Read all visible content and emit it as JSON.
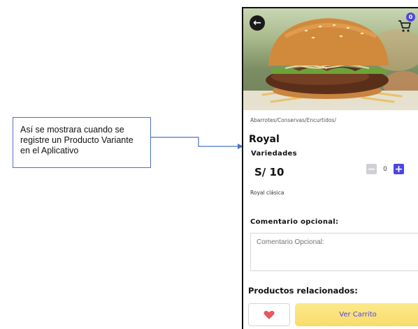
{
  "annotation": {
    "lines": [
      "Así se mostrara cuando se",
      "registre un Producto Variante",
      "en el Aplicativo"
    ]
  },
  "header": {
    "back_icon": "arrow-left-icon",
    "cart_icon": "cart-icon",
    "cart_count": "0"
  },
  "product": {
    "breadcrumb": "Abarrotes/Conservas/Encurtidos/",
    "name": "Royal",
    "variants_label": "Variedades",
    "price": "S/ 10",
    "quantity": "0",
    "variant_name": "Royal clásica"
  },
  "comment": {
    "label": "Comentario opcional:",
    "placeholder": "Comentario Opcional:"
  },
  "related": {
    "label": "Productos relacionados:"
  },
  "actions": {
    "favorite_icon": "heart-icon",
    "cart_label": "Ver Carrito"
  },
  "colors": {
    "accent": "#4b45e4",
    "cart_button": "#f9dc6a",
    "heart": "#e8575f"
  }
}
